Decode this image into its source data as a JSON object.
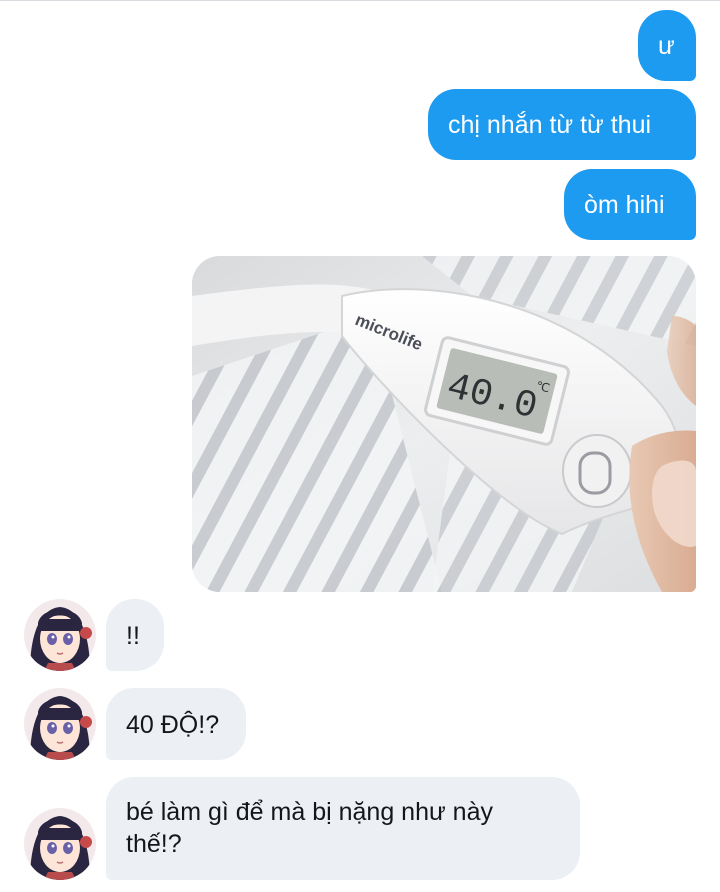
{
  "conversation": {
    "sent_messages": [
      {
        "text": "ư"
      },
      {
        "text": "chị nhắn từ từ thui"
      },
      {
        "text": "òm hihi"
      }
    ],
    "photo": {
      "brand": "microlife",
      "display_reading": "40.0",
      "display_unit": "℃"
    },
    "received_messages": [
      {
        "text": "!!"
      },
      {
        "text": "40 ĐỘ!?"
      },
      {
        "line1": "bé làm gì để mà bị nặng như này",
        "line2": "thế!?"
      }
    ]
  },
  "colors": {
    "sent_bubble": "#1d9bf0",
    "received_bubble": "#eceff3",
    "received_text": "#14171a"
  },
  "icons": {
    "avatar": "anime-character-avatar"
  }
}
